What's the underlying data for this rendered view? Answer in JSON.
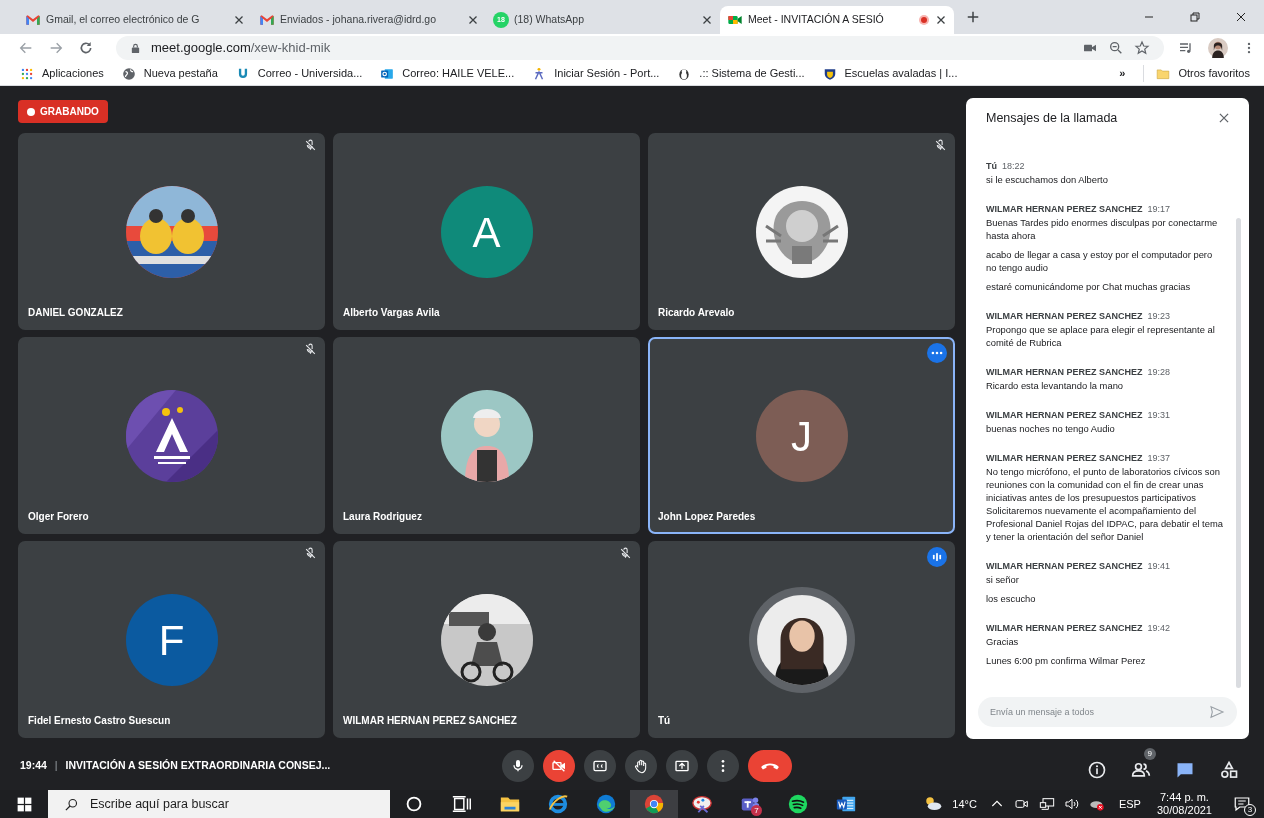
{
  "browser": {
    "tabs": [
      {
        "title": "Gmail, el correo electrónico de G",
        "selected": false
      },
      {
        "title": "Enviados - johana.rivera@idrd.go",
        "selected": false
      },
      {
        "title": "(18) WhatsApp",
        "icon_badge": "18",
        "selected": false
      },
      {
        "title": "Meet - INVITACIÓN A SESIÓ",
        "recording": true,
        "selected": true
      }
    ],
    "address": {
      "host": "meet.google.com",
      "path": "/xew-khid-mik"
    },
    "bookmarks": [
      {
        "label": "Aplicaciones"
      },
      {
        "label": "Nueva pestaña"
      },
      {
        "label": "Correo - Universida..."
      },
      {
        "label": "Correo: HAILE VELE..."
      },
      {
        "label": "Iniciar Sesión - Port..."
      },
      {
        "label": ".:: Sistema de Gesti..."
      },
      {
        "label": "Escuelas avaladas | I..."
      }
    ],
    "bookmarks_overflow": "»",
    "other_bookmarks": "Otros favoritos"
  },
  "meeting": {
    "recording_label": "GRABANDO",
    "tiles": [
      {
        "name": "DANIEL GONZALEZ",
        "muted": true,
        "selected": false,
        "speaking": false
      },
      {
        "name": "Alberto Vargas Avila",
        "avatar": {
          "kind": "letter",
          "letter": "A",
          "color": "#0f8a7a"
        },
        "muted": false,
        "selected": false,
        "speaking": false
      },
      {
        "name": "Ricardo Arevalo",
        "muted": true,
        "selected": false,
        "speaking": false
      },
      {
        "name": "Olger Forero",
        "muted": true,
        "selected": false,
        "speaking": false
      },
      {
        "name": "Laura Rodriguez",
        "muted": false,
        "selected": false,
        "speaking": false
      },
      {
        "name": "John Lopez Paredes",
        "avatar": {
          "kind": "letter",
          "letter": "J",
          "color": "#7d5d55"
        },
        "muted": false,
        "selected": true,
        "speaking": false
      },
      {
        "name": "Fidel Ernesto Castro Suescun",
        "avatar": {
          "kind": "letter",
          "letter": "F",
          "color": "#0b5aa0"
        },
        "muted": true,
        "selected": false,
        "speaking": false
      },
      {
        "name": "WILMAR HERNAN PEREZ SANCHEZ",
        "muted": true,
        "selected": false,
        "speaking": false
      },
      {
        "name": "Tú",
        "muted": false,
        "selected": false,
        "speaking": true
      }
    ],
    "time": "19:44",
    "separator": "|",
    "title": "INVITACIÓN A SESIÓN EXTRAORDINARIA CONSEJ...",
    "controls": [
      {
        "kind": "mic",
        "off": false
      },
      {
        "kind": "camera",
        "off": true
      },
      {
        "kind": "captions",
        "off": false
      },
      {
        "kind": "hand",
        "off": false
      },
      {
        "kind": "present",
        "off": false
      },
      {
        "kind": "more",
        "off": false
      },
      {
        "kind": "end",
        "off": false
      }
    ],
    "side_buttons": [
      {
        "kind": "info",
        "selected": false
      },
      {
        "kind": "people",
        "badge": "9",
        "selected": false
      },
      {
        "kind": "chat",
        "selected": true
      },
      {
        "kind": "activities",
        "selected": false
      }
    ]
  },
  "chat": {
    "title": "Mensajes de la llamada",
    "groups": [
      {
        "sender": "Tú",
        "time": "18:22",
        "messages": [
          "si le escuchamos don Alberto"
        ]
      },
      {
        "sender": "WILMAR HERNAN PEREZ SANCHEZ",
        "time": "19:17",
        "messages": [
          "Buenas Tardes pido enormes disculpas por conectarme hasta ahora",
          "acabo de llegar a casa y estoy por el computador pero no tengo audio",
          "estaré comunicándome por Chat muchas gracias"
        ]
      },
      {
        "sender": "WILMAR HERNAN PEREZ SANCHEZ",
        "time": "19:23",
        "messages": [
          "Propongo que se aplace para elegir el representante al comité de Rubrica"
        ]
      },
      {
        "sender": "WILMAR HERNAN PEREZ SANCHEZ",
        "time": "19:28",
        "messages": [
          "Ricardo esta levantando la mano"
        ]
      },
      {
        "sender": "WILMAR HERNAN PEREZ SANCHEZ",
        "time": "19:31",
        "messages": [
          "buenas noches no tengo Audio"
        ]
      },
      {
        "sender": "WILMAR HERNAN PEREZ SANCHEZ",
        "time": "19:37",
        "messages": [
          "No tengo micrófono, el punto de laboratorios cívicos son reuniones con la comunidad con el fin de crear unas iniciativas antes de los presupuestos participativos Solicitaremos nuevamente el acompañamiento del Profesional Daniel Rojas del IDPAC, para debatir el tema y tener la orientación del señor Daniel"
        ]
      },
      {
        "sender": "WILMAR HERNAN PEREZ SANCHEZ",
        "time": "19:41",
        "messages": [
          "si señor",
          "los escucho"
        ]
      },
      {
        "sender": "WILMAR HERNAN PEREZ SANCHEZ",
        "time": "19:42",
        "messages": [
          "Gracias",
          "Lunes 6:00 pm confirma Wilmar Perez"
        ]
      }
    ],
    "placeholder": "Envía un mensaje a todos"
  },
  "taskbar": {
    "search_placeholder": "Escribe aquí para buscar",
    "apps": [
      {
        "kind": "cortana",
        "selected": false
      },
      {
        "kind": "task-view",
        "selected": false
      },
      {
        "kind": "explorer",
        "selected": false
      },
      {
        "kind": "ie",
        "selected": false
      },
      {
        "kind": "edge",
        "selected": false
      },
      {
        "kind": "chrome",
        "selected": true
      },
      {
        "kind": "snip",
        "selected": false
      },
      {
        "kind": "teams",
        "badge": "7",
        "selected": false
      },
      {
        "kind": "spotify",
        "selected": false
      },
      {
        "kind": "word",
        "selected": false
      }
    ],
    "temperature": "14°C",
    "tray": [
      {
        "kind": "chevron"
      },
      {
        "kind": "meet-now"
      },
      {
        "kind": "network"
      },
      {
        "kind": "volume"
      },
      {
        "kind": "onedrive"
      }
    ],
    "language": "ESP",
    "time": "7:44 p. m.",
    "date": "30/08/2021",
    "notifications": "3"
  }
}
